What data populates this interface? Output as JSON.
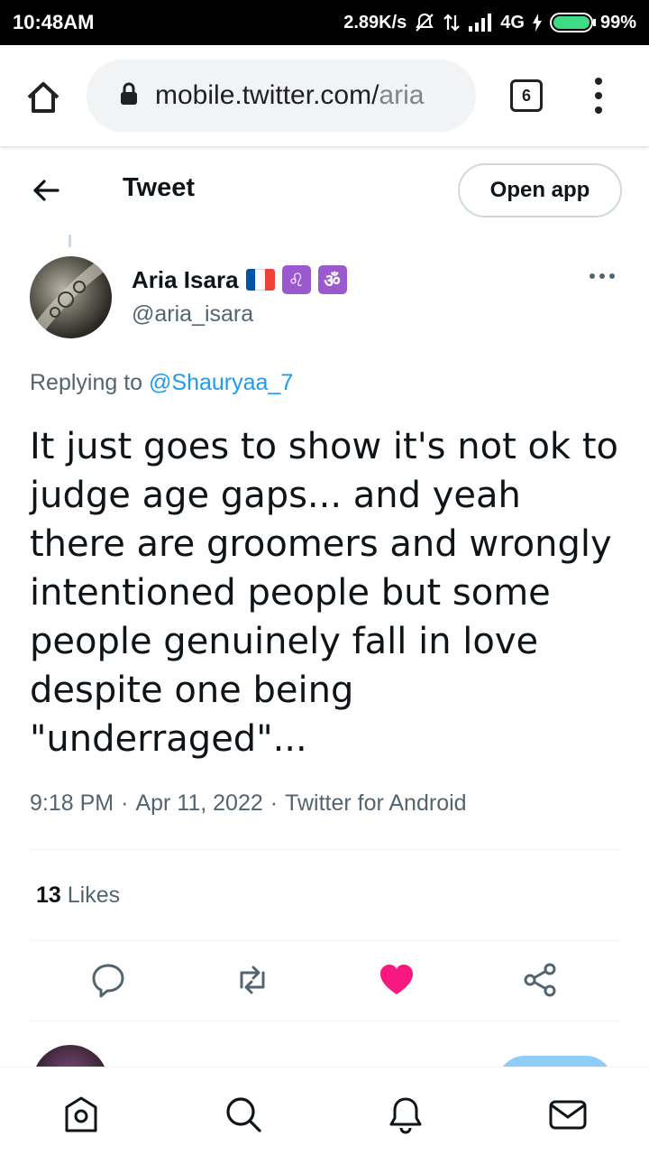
{
  "status_bar": {
    "time": "10:48AM",
    "net_speed": "2.89K/s",
    "network": "4G",
    "battery": "99%"
  },
  "browser": {
    "url_main": "mobile.twitter.com/",
    "url_dim": "aria",
    "tab_count": "6"
  },
  "header": {
    "title": "Tweet",
    "open_app_label": "Open app"
  },
  "tweet": {
    "author_name": "Aria Isara",
    "author_emojis": [
      "♌",
      "ॐ"
    ],
    "handle": "@aria_isara",
    "replying_prefix": "Replying to",
    "replying_to": "@Shauryaa_7",
    "text": "It just goes to show it's not ok to judge age gaps... and yeah there are groomers and wrongly intentioned people but some people genuinely fall in love despite one being \"underraged\"...",
    "time": "9:18 PM",
    "date": "Apr 11, 2022",
    "source": "Twitter for Android",
    "separator": "·",
    "likes_count": "13",
    "likes_label": "Likes",
    "liked": true
  },
  "colors": {
    "accent": "#1d9bf0",
    "like": "#f91880",
    "secondary_text": "#536471",
    "emoji_box": "#9b59d0"
  },
  "icons": {
    "actions": [
      "reply-icon",
      "retweet-icon",
      "like-icon",
      "share-icon"
    ],
    "nav": [
      "home-icon",
      "search-icon",
      "notifications-icon",
      "messages-icon"
    ]
  }
}
